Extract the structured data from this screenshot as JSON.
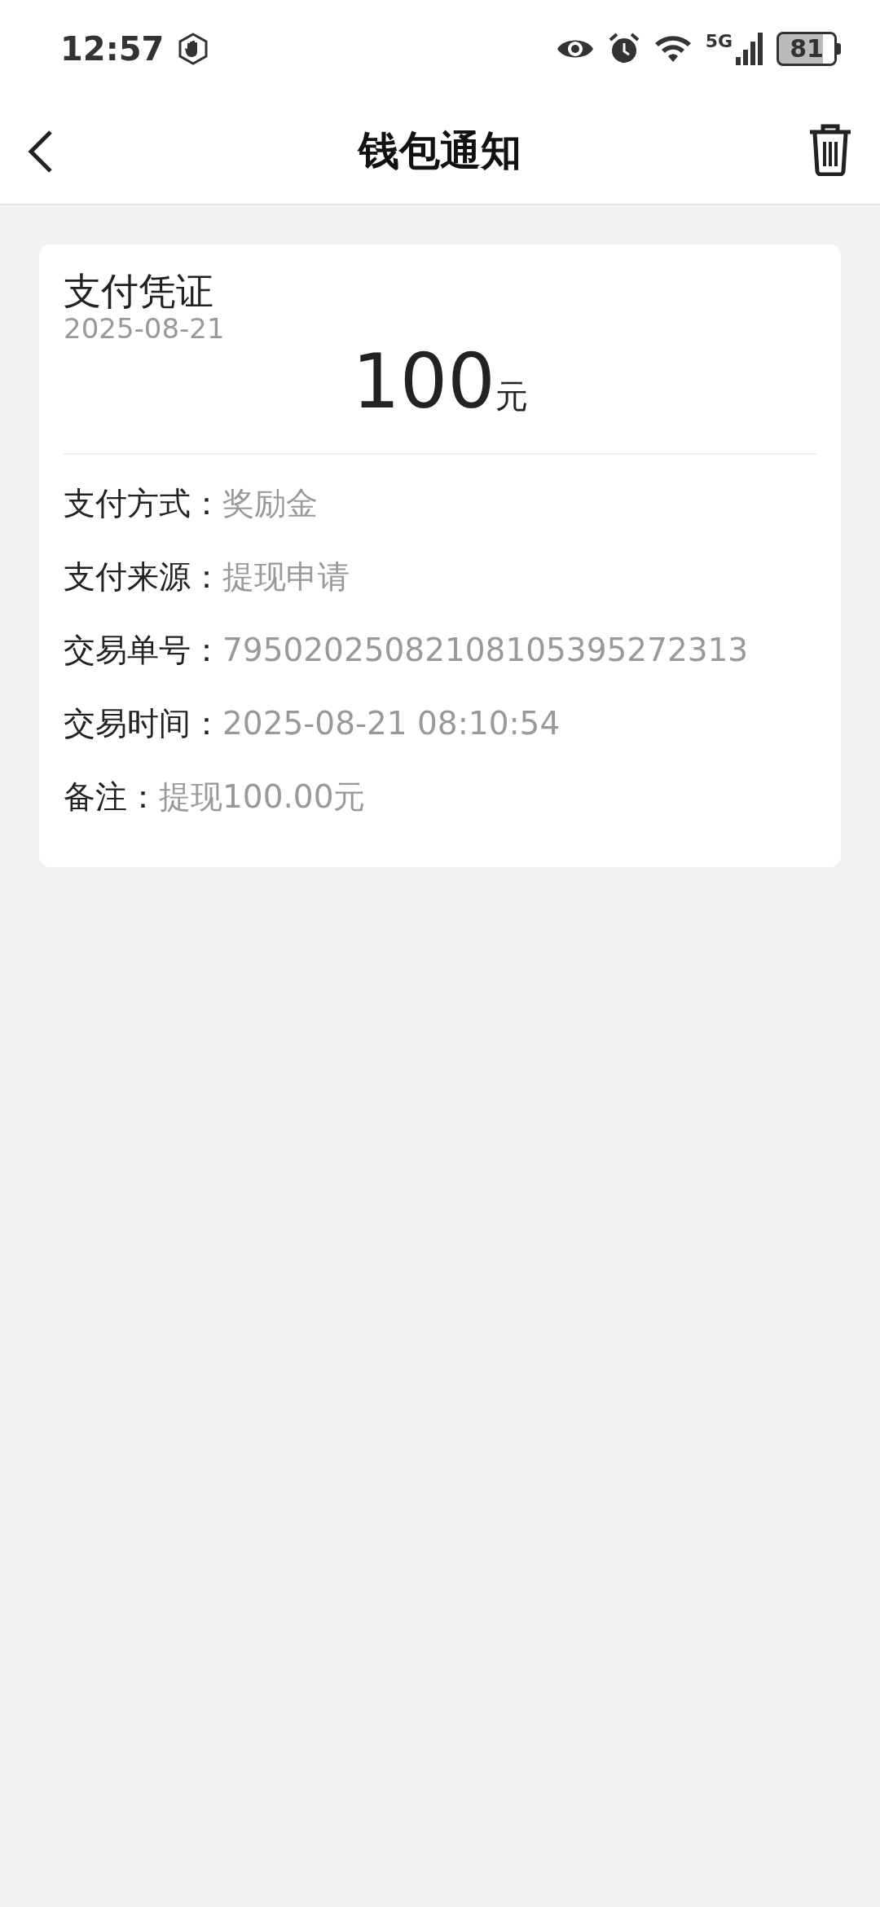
{
  "status_bar": {
    "time": "12:57",
    "network": "5G",
    "battery": "81"
  },
  "header": {
    "title": "钱包通知"
  },
  "card": {
    "title": "支付凭证",
    "date": "2025-08-21",
    "amount": "100",
    "unit": "元",
    "rows": [
      {
        "label": "支付方式：",
        "value": "奖励金"
      },
      {
        "label": "支付来源：",
        "value": "提现申请"
      },
      {
        "label": "交易单号：",
        "value": "79502025082108105395272313"
      },
      {
        "label": "交易时间：",
        "value": "2025-08-21 08:10:54"
      },
      {
        "label": "备注：",
        "value": "提现100.00元"
      }
    ]
  }
}
